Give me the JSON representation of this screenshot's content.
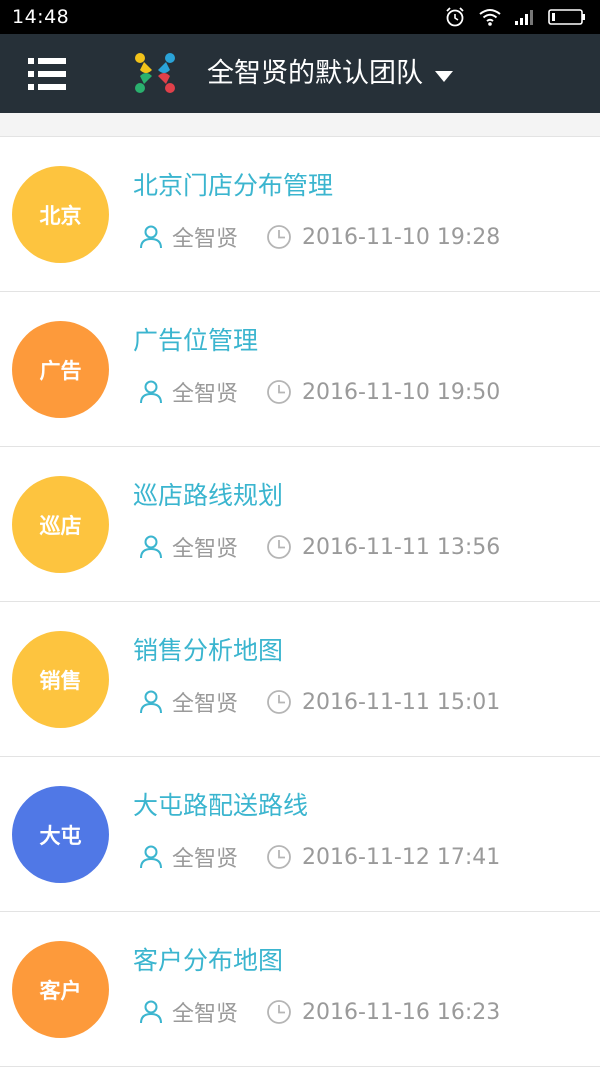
{
  "status_bar": {
    "time": "14:48",
    "icons": [
      "alarm-icon",
      "wifi-icon",
      "signal-icon",
      "battery-icon"
    ]
  },
  "app_bar": {
    "menu_icon": "menu-list-icon",
    "logo_icon": "team-logo-icon",
    "team_name": "全智贤的默认团队",
    "dropdown_icon": "caret-down-icon"
  },
  "colors": {
    "app_bar_bg": "#263038",
    "title_color": "#3bb5cf",
    "meta_color": "#9a9a9a",
    "yellow": "#fdc43f",
    "orange": "#fd9a3b",
    "blue": "#5078e6"
  },
  "items": [
    {
      "badge": "北京",
      "badge_color": "#fdc43f",
      "title": "北京门店分布管理",
      "author": "全智贤",
      "time": "2016-11-10 19:28"
    },
    {
      "badge": "广告",
      "badge_color": "#fd9a3b",
      "title": "广告位管理",
      "author": "全智贤",
      "time": "2016-11-10 19:50"
    },
    {
      "badge": "巡店",
      "badge_color": "#fdc43f",
      "title": "巡店路线规划",
      "author": "全智贤",
      "time": "2016-11-11 13:56"
    },
    {
      "badge": "销售",
      "badge_color": "#fdc43f",
      "title": "销售分析地图",
      "author": "全智贤",
      "time": "2016-11-11 15:01"
    },
    {
      "badge": "大屯",
      "badge_color": "#5078e6",
      "title": "大屯路配送路线",
      "author": "全智贤",
      "time": "2016-11-12 17:41"
    },
    {
      "badge": "客户",
      "badge_color": "#fd9a3b",
      "title": "客户分布地图",
      "author": "全智贤",
      "time": "2016-11-16 16:23"
    }
  ]
}
